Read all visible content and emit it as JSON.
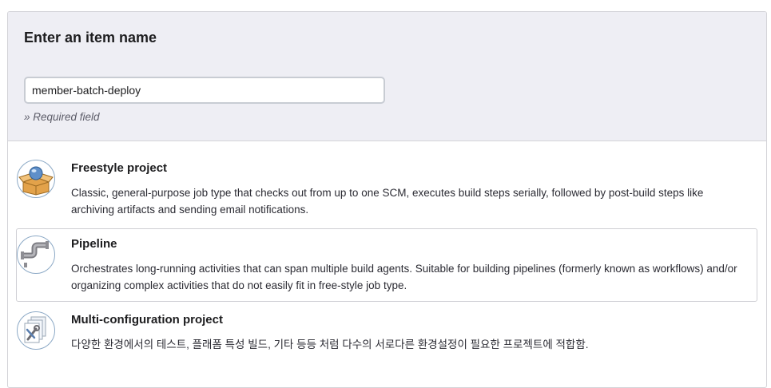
{
  "header": {
    "title": "Enter an item name",
    "item_name_value": "member-batch-deploy",
    "required_note": "» Required field"
  },
  "job_types": [
    {
      "name": "Freestyle project",
      "icon": "freestyle-project-icon",
      "description": "Classic, general-purpose job type that checks out from up to one SCM, executes build steps serially, followed by post-build steps like archiving artifacts and sending email notifications.",
      "selected": false
    },
    {
      "name": "Pipeline",
      "icon": "pipeline-icon",
      "description": "Orchestrates long-running activities that can span multiple build agents. Suitable for building pipelines (formerly known as workflows) and/or organizing complex activities that do not easily fit in free-style job type.",
      "selected": true
    },
    {
      "name": "Multi-configuration project",
      "icon": "multi-configuration-project-icon",
      "description": "다양한 환경에서의 테스트, 플래폼 특성 빌드, 기타 등등 처럼 다수의 서로다른 환경설정이 필요한 프로젝트에 적합함.",
      "selected": false
    }
  ]
}
